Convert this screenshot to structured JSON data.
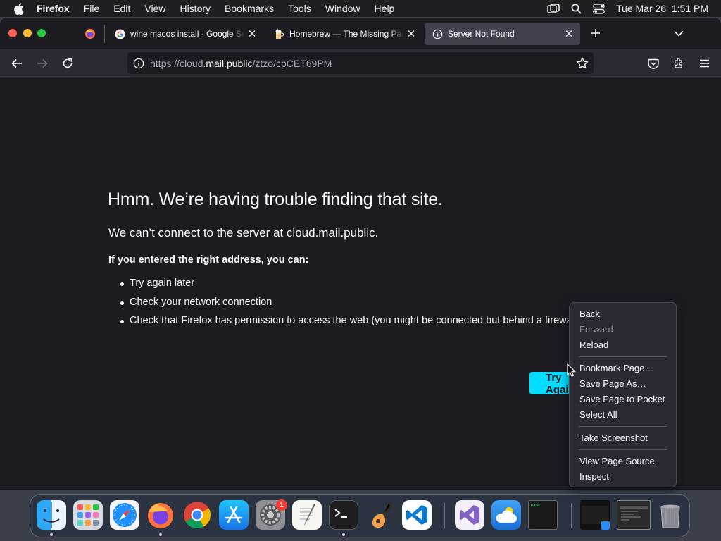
{
  "menubar": {
    "app_name": "Firefox",
    "items": [
      "File",
      "Edit",
      "View",
      "History",
      "Bookmarks",
      "Tools",
      "Window",
      "Help"
    ],
    "clock": "Tue Mar 26  1:51 PM"
  },
  "tabs": [
    {
      "label": "wine macos install - Google Search",
      "icon": "google-icon",
      "active": false
    },
    {
      "label": "Homebrew — The Missing Package Manager",
      "icon": "homebrew-icon",
      "active": false
    },
    {
      "label": "Server Not Found",
      "icon": "info-icon",
      "active": true
    }
  ],
  "urlbar": {
    "prefix": "https://cloud.",
    "host": "mail.public",
    "suffix": "/ztzo/cpCET69PM"
  },
  "error_page": {
    "title": "Hmm. We’re having trouble finding that site.",
    "message": "We can’t connect to the server at cloud.mail.public.",
    "subheading": "If you entered the right address, you can:",
    "suggestions": [
      "Try again later",
      "Check your network connection",
      "Check that Firefox has permission to access the web (you might be connected but behind a firewall)"
    ],
    "try_again_label": "Try Again"
  },
  "context_menu": {
    "groups": [
      [
        {
          "label": "Back",
          "enabled": true
        },
        {
          "label": "Forward",
          "enabled": false
        },
        {
          "label": "Reload",
          "enabled": true
        }
      ],
      [
        {
          "label": "Bookmark Page…",
          "enabled": true
        },
        {
          "label": "Save Page As…",
          "enabled": true
        },
        {
          "label": "Save Page to Pocket",
          "enabled": true
        },
        {
          "label": "Select All",
          "enabled": true
        }
      ],
      [
        {
          "label": "Take Screenshot",
          "enabled": true
        }
      ],
      [
        {
          "label": "View Page Source",
          "enabled": true
        },
        {
          "label": "Inspect",
          "enabled": true
        }
      ]
    ]
  },
  "dock": {
    "apps": [
      "finder",
      "launchpad",
      "safari",
      "firefox",
      "chrome",
      "app-store",
      "system-settings",
      "textedit",
      "terminal",
      "garageband",
      "vscode",
      "visual-studio",
      "weather",
      "exec-terminal",
      "window-preview-1",
      "window-preview-2",
      "trash"
    ],
    "system_settings_badge": "1",
    "exec_label": "exec"
  },
  "colors": {
    "accent": "#00ddff",
    "page_bg": "#1c1b22",
    "toolbar_bg": "#2b2a33",
    "menu_bg": "#2b2a33"
  }
}
